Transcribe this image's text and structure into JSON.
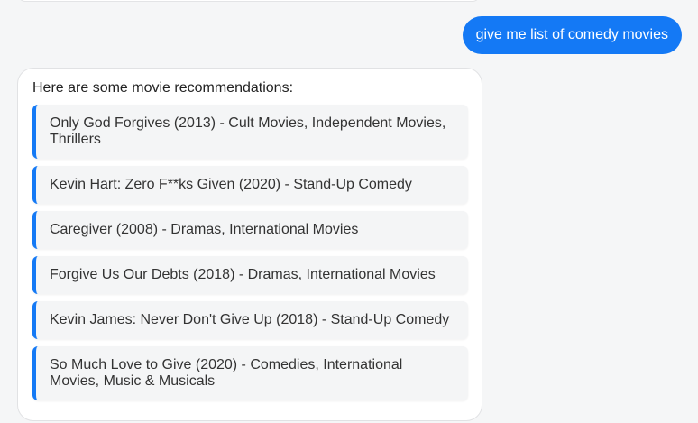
{
  "user_message": "give me list of comedy movies",
  "bot_intro": "Here are some movie recommendations:",
  "movies": [
    "Only God Forgives (2013) - Cult Movies, Independent Movies, Thrillers",
    "Kevin Hart: Zero F**ks Given (2020) - Stand-Up Comedy",
    "Caregiver (2008) - Dramas, International Movies",
    "Forgive Us Our Debts (2018) - Dramas, International Movies",
    "Kevin James: Never Don't Give Up (2018) - Stand-Up Comedy",
    "So Much Love to Give (2020) - Comedies, International Movies, Music & Musicals"
  ],
  "colors": {
    "accent": "#1479f5",
    "background": "#f5f6f7",
    "item_background": "#f4f5f6"
  }
}
